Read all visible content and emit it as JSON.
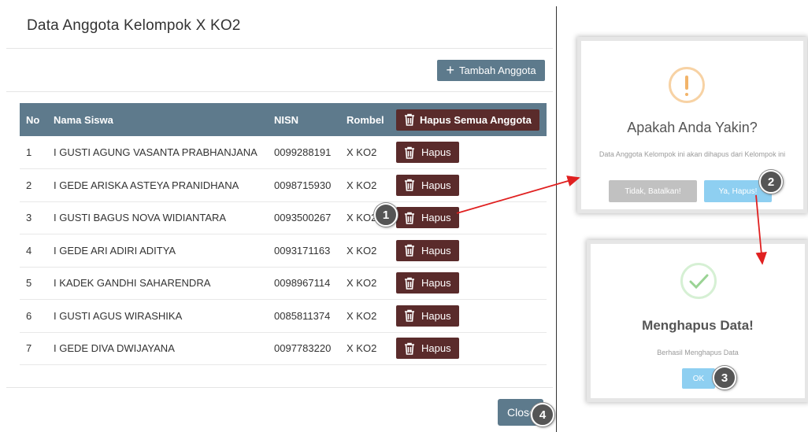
{
  "modal": {
    "title": "Data Anggota Kelompok X KO2",
    "add_label": "Tambah Anggota",
    "close_label": "Close"
  },
  "table": {
    "headers": {
      "no": "No",
      "name": "Nama Siswa",
      "nisn": "NISN",
      "rombel": "Rombel",
      "delete_all": "Hapus Semua Anggota"
    },
    "delete_label": "Hapus",
    "rows": [
      {
        "no": "1",
        "name": "I GUSTI AGUNG VASANTA PRABHANJANA",
        "nisn": "0099288191",
        "rombel": "X KO2"
      },
      {
        "no": "2",
        "name": "I GEDE ARISKA ASTEYA PRANIDHANA",
        "nisn": "0098715930",
        "rombel": "X KO2"
      },
      {
        "no": "3",
        "name": "I GUSTI BAGUS NOVA WIDIANTARA",
        "nisn": "0093500267",
        "rombel": "X KO2"
      },
      {
        "no": "4",
        "name": "I GEDE ARI ADIRI ADITYA",
        "nisn": "0093171163",
        "rombel": "X KO2"
      },
      {
        "no": "5",
        "name": "I KADEK GANDHI SAHARENDRA",
        "nisn": "0098967114",
        "rombel": "X KO2"
      },
      {
        "no": "6",
        "name": "I GUSTI AGUS WIRASHIKA",
        "nisn": "0085811374",
        "rombel": "X KO2"
      },
      {
        "no": "7",
        "name": "I GEDE DIVA DWIJAYANA",
        "nisn": "0097783220",
        "rombel": "X KO2"
      }
    ]
  },
  "confirm_dialog": {
    "icon": "warning-icon",
    "title": "Apakah Anda Yakin?",
    "text": "Data Anggota Kelompok ini akan dihapus dari Kelompok ini",
    "cancel_label": "Tidak, Batalkan!",
    "confirm_label": "Ya, Hapus!"
  },
  "success_dialog": {
    "icon": "checkmark-icon",
    "title": "Menghapus Data!",
    "text": "Berhasil Menghapus Data",
    "ok_label": "OK"
  },
  "steps": {
    "s1": "1",
    "s2": "2",
    "s3": "3",
    "s4": "4"
  },
  "colors": {
    "header": "#5e7a8c",
    "delete_button": "#5a2b2b",
    "primary_button": "#5d7a8c",
    "arrow": "#e02020",
    "confirm_button": "#8ecff1"
  }
}
